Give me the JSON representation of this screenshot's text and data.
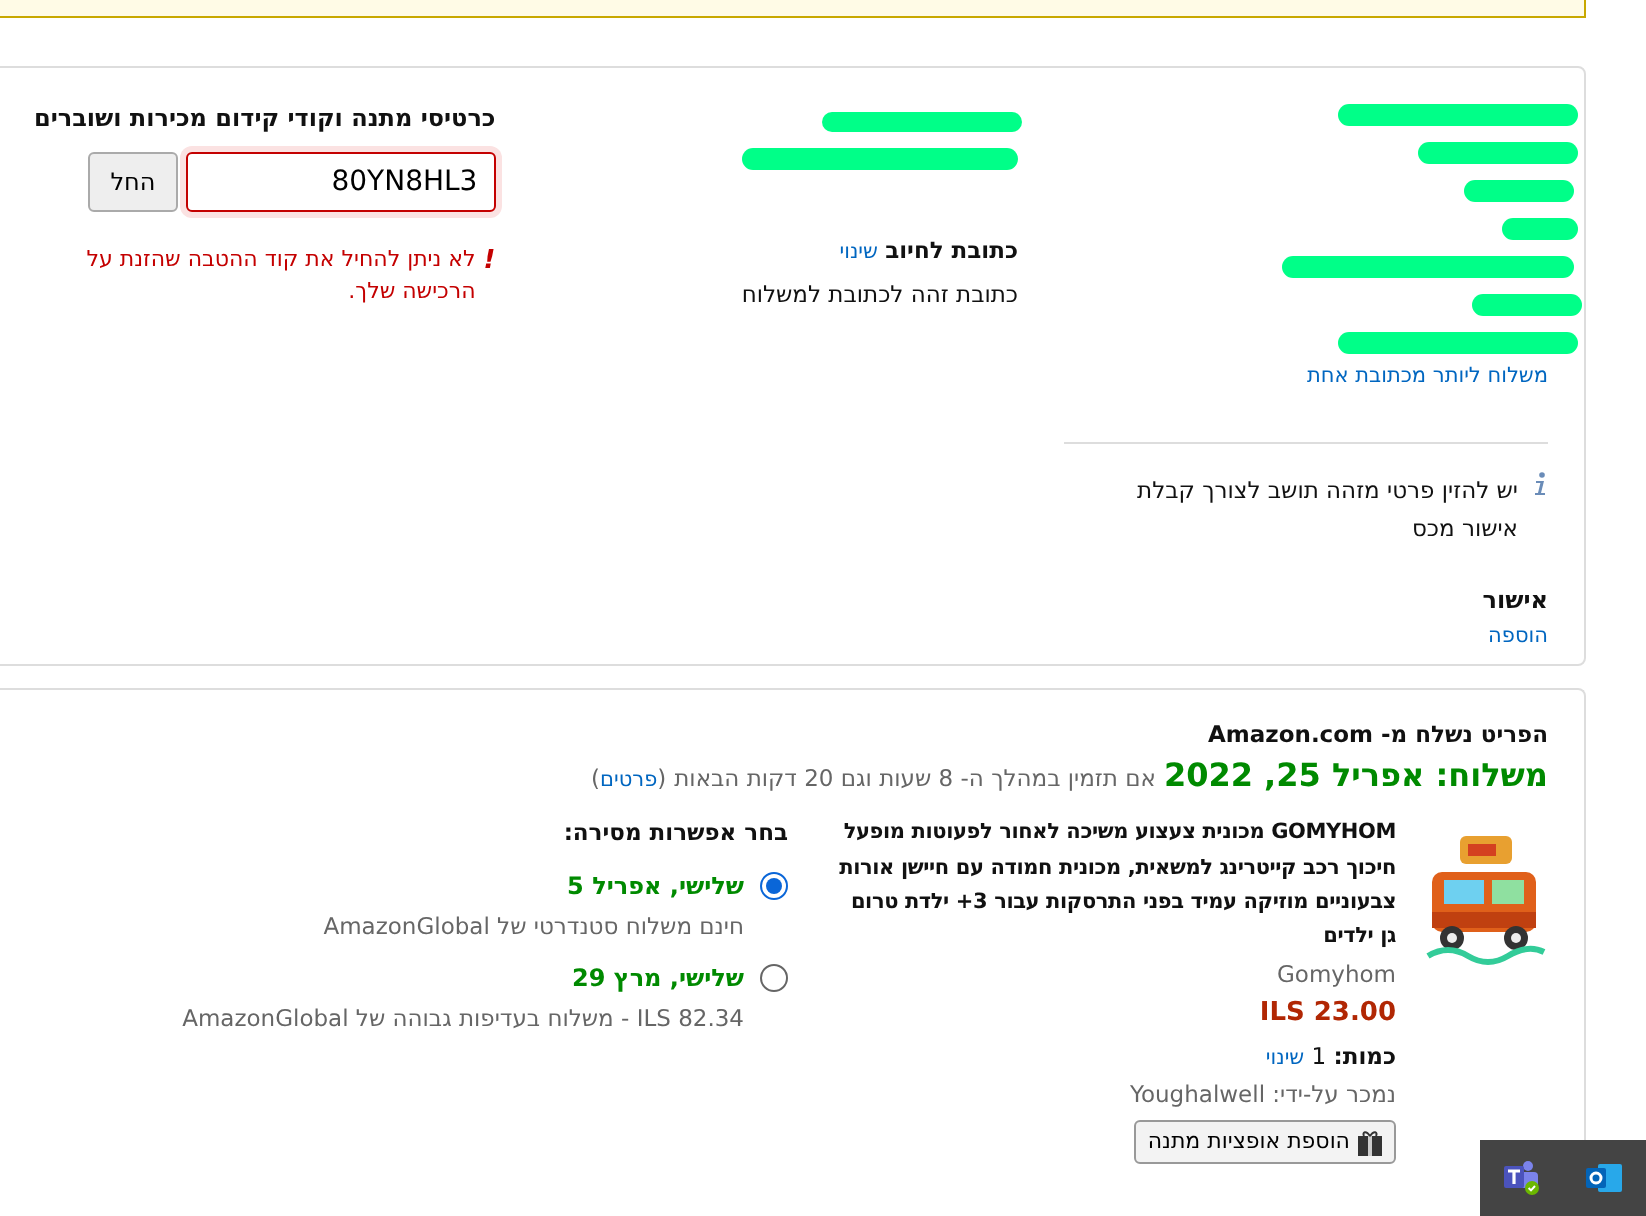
{
  "shipping_address": {
    "link": "משלוח ליותר מכתובת אחת"
  },
  "billing": {
    "title": "כתובת לחיוב",
    "change": "שינוי",
    "note": "כתובת זהה לכתובת למשלוח"
  },
  "tax_note": {
    "text": "יש להזין פרטי מזהה תושב לצורך קבלת אישור מכס",
    "title": "אישור",
    "add": "הוספה"
  },
  "gift_cards": {
    "title": "כרטיסי מתנה וקודי קידום מכירות ושוברים",
    "value": "80YN8HL3",
    "apply": "החל",
    "error_mark": "!",
    "error": "לא ניתן להחיל את קוד ההטבה שהזנת על הרכישה שלך."
  },
  "shipment": {
    "shipped_from": "הפריט נשלח מ- Amazon.com",
    "delivery": "משלוח: אפריל 25, 2022",
    "order_within": "אם תזמין במהלך ה-  8 שעות וגם 20 דקות הבאות",
    "details_open": "(",
    "details": "פרטים",
    "details_close": ")",
    "item": {
      "kind": "picture",
      "title": "GOMYHOM מכונית צעצוע משיכה לאחור לפעוטות מופעל חיכוך רכב קייטרינג למשאית, מכונית חמודה עם חיישן אורות צבעוניים מוזיקה עמיד בפני התרסקות עבור 3+ ילדת טרום גן ילדים",
      "brand": "Gomyhom",
      "price": "ILS 23.00",
      "qty_label": "כמות:",
      "qty": "1",
      "qty_change": "שינוי",
      "seller": "נמכר על-ידי: Youghalwell",
      "gift_button": "הוספת אופציות מתנה"
    },
    "options_title": "בחר אפשרות מסירה:",
    "options": [
      {
        "date": "שלישי, אפריל 5",
        "desc": "חינם משלוח סטנדרטי של AmazonGlobal",
        "selected": true
      },
      {
        "date": "שלישי, מרץ 29",
        "desc": "ILS 82.34 - משלוח בעדיפות גבוהה של AmazonGlobal",
        "selected": false
      }
    ]
  }
}
